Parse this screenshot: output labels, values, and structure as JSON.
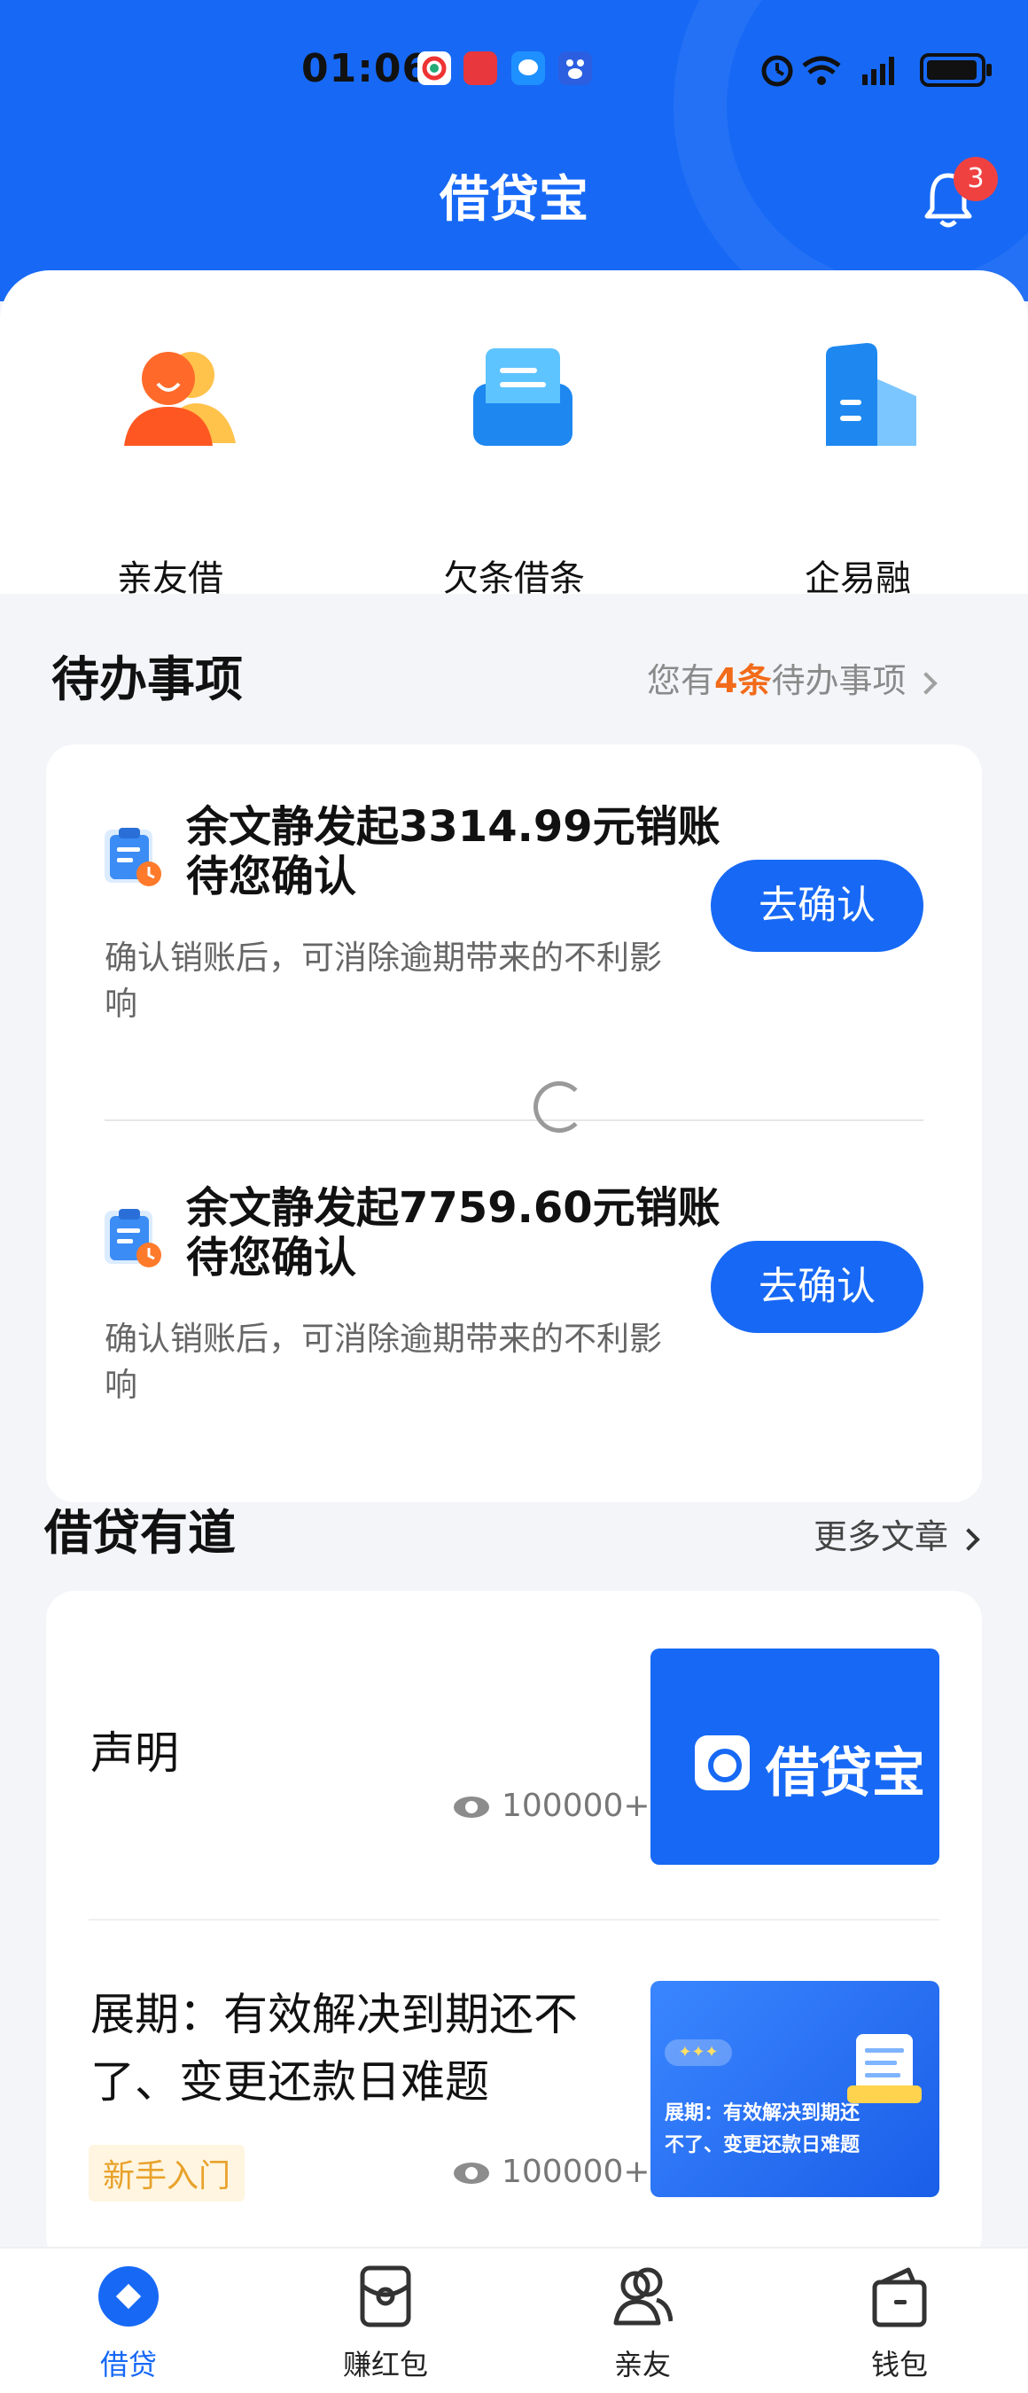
{
  "status_bar": {
    "time": "01:06"
  },
  "header": {
    "title": "借贷宝",
    "notification_count": "3"
  },
  "quick_actions": [
    {
      "label": "亲友借",
      "icon": "friends-icon"
    },
    {
      "label": "欠条借条",
      "icon": "iou-icon"
    },
    {
      "label": "企易融",
      "icon": "building-icon"
    }
  ],
  "todo": {
    "title": "待办事项",
    "summary_prefix": "您有",
    "summary_count": "4条",
    "summary_suffix": "待办事项",
    "items": [
      {
        "title": "余文静发起3314.99元销账待您确认",
        "desc": "确认销账后，可消除逾期带来的不利影响",
        "button": "去确认"
      },
      {
        "title": "余文静发起7759.60元销账待您确认",
        "desc": "确认销账后，可消除逾期带来的不利影响",
        "button": "去确认"
      }
    ]
  },
  "articles": {
    "title": "借贷有道",
    "more": "更多文章",
    "items": [
      {
        "title": "声明",
        "views": "100000+",
        "thumb_text": "借贷宝"
      },
      {
        "title": "展期：有效解决到期还不了、变更还款日难题",
        "views": "100000+",
        "tag": "新手入门",
        "thumb_text": "展期：有效解决到期还不了、变更还款日难题",
        "thumb_pill": "✦✦✦"
      }
    ]
  },
  "bottom_nav": [
    {
      "label": "借贷",
      "active": true
    },
    {
      "label": "赚红包",
      "active": false
    },
    {
      "label": "亲友",
      "active": false
    },
    {
      "label": "钱包",
      "active": false
    }
  ],
  "colors": {
    "brand_blue": "#1769f5",
    "highlight_orange": "#f26b1a",
    "badge_red": "#f04141"
  }
}
